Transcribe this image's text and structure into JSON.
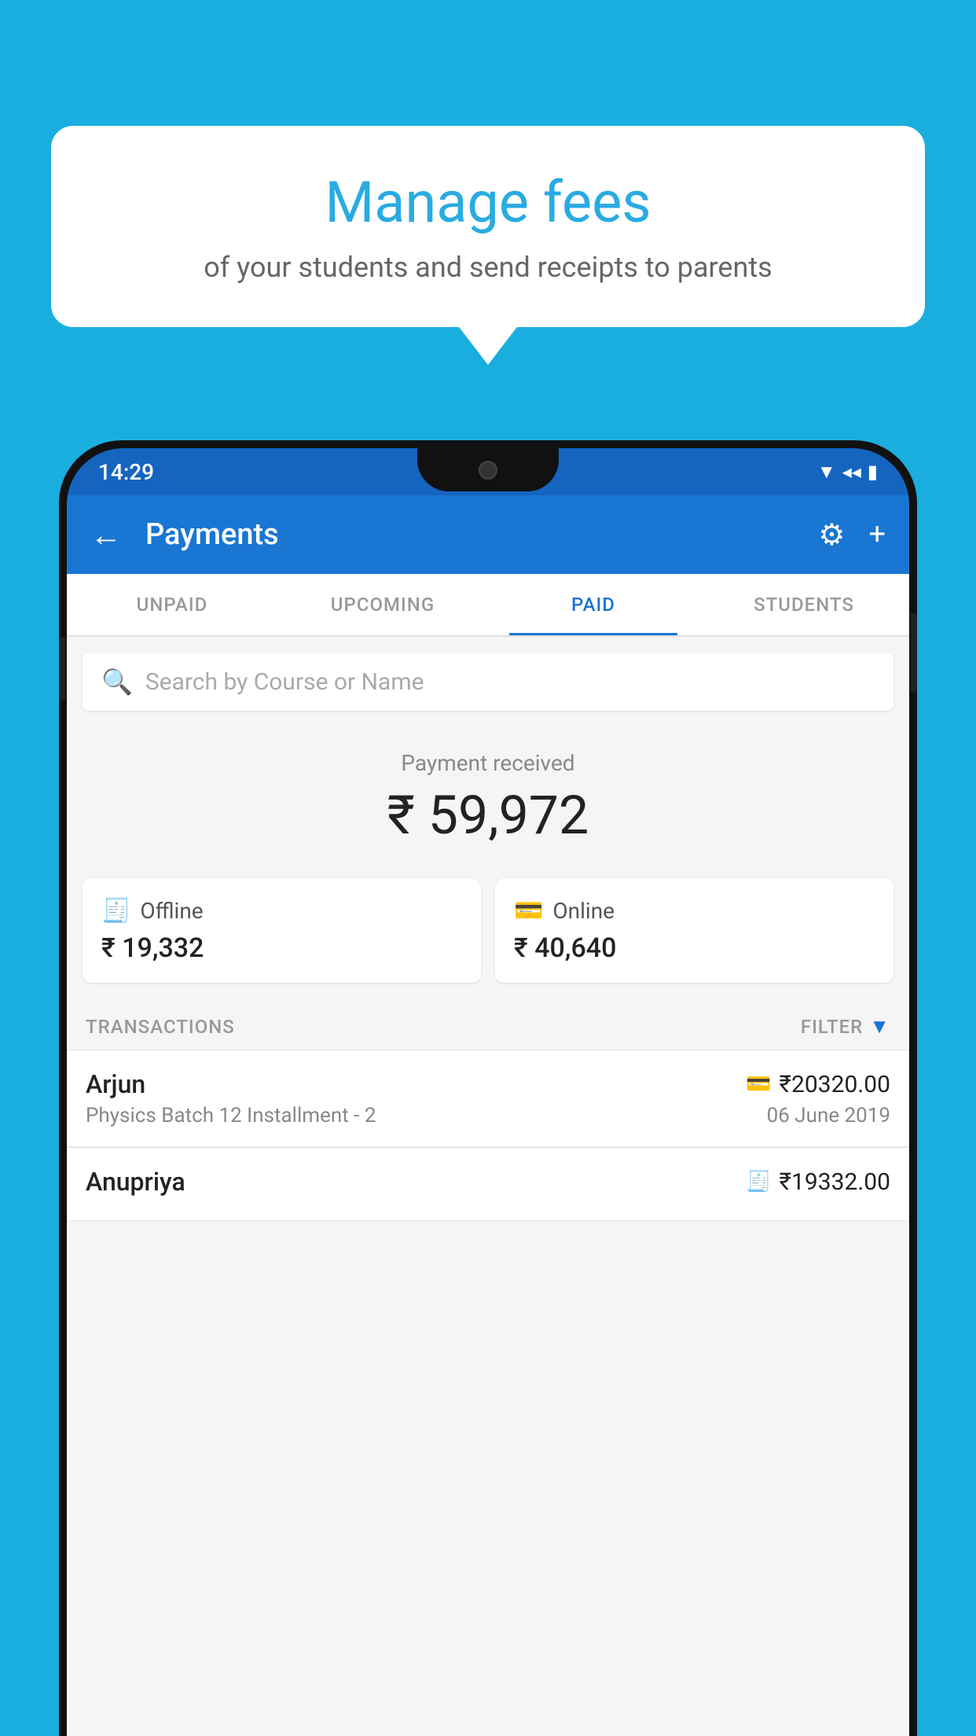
{
  "background_color": "#1AAEDF",
  "bubble": {
    "title": "Manage fees",
    "subtitle": "of your students and send receipts to parents"
  },
  "phone": {
    "status_bar": {
      "time": "14:29"
    },
    "app_bar": {
      "title": "Payments",
      "back_label": "←",
      "gear_label": "⚙",
      "plus_label": "+"
    },
    "tabs": [
      {
        "label": "UNPAID",
        "active": false
      },
      {
        "label": "UPCOMING",
        "active": false
      },
      {
        "label": "PAID",
        "active": true
      },
      {
        "label": "STUDENTS",
        "active": false
      }
    ],
    "search": {
      "placeholder": "Search by Course or Name"
    },
    "payment_summary": {
      "label": "Payment received",
      "amount": "₹ 59,972"
    },
    "cards": [
      {
        "type": "offline",
        "label": "Offline",
        "amount": "₹ 19,332"
      },
      {
        "type": "online",
        "label": "Online",
        "amount": "₹ 40,640"
      }
    ],
    "transactions_label": "TRANSACTIONS",
    "filter_label": "FILTER",
    "transactions": [
      {
        "name": "Arjun",
        "description": "Physics Batch 12 Installment - 2",
        "amount": "₹20320.00",
        "date": "06 June 2019",
        "payment_type": "online"
      },
      {
        "name": "Anupriya",
        "description": "",
        "amount": "₹19332.00",
        "date": "",
        "payment_type": "offline"
      }
    ]
  }
}
